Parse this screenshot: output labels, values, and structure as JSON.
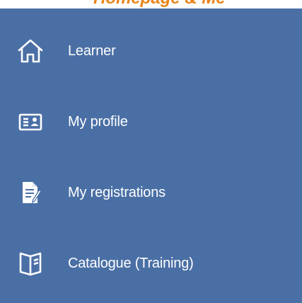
{
  "header": {
    "title": "Homepage & Me"
  },
  "menu": {
    "items": [
      {
        "label": "Learner",
        "icon": "home-icon"
      },
      {
        "label": "My profile",
        "icon": "id-card-icon"
      },
      {
        "label": "My registrations",
        "icon": "document-pen-icon"
      },
      {
        "label": "Catalogue (Training)",
        "icon": "open-book-icon"
      }
    ]
  },
  "colors": {
    "panel_background": "#4a6fa5",
    "text": "#ffffff",
    "title": "#e8841a"
  }
}
